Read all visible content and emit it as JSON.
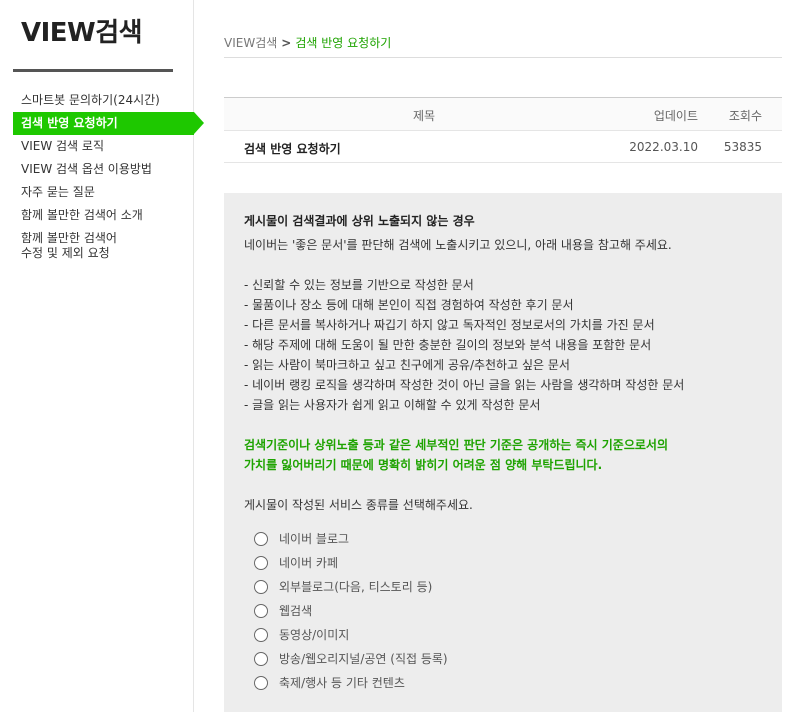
{
  "brand": "VIEW검색",
  "nav": [
    "스마트봇 문의하기(24시간)",
    "검색 반영 요청하기",
    "VIEW 검색 로직",
    "VIEW 검색 옵션 이용방법",
    "자주 묻는 질문",
    "함께 볼만한 검색어 소개",
    "함께 볼만한 검색어\n수정 및 제외 요청"
  ],
  "breadcrumb": {
    "root": "VIEW검색",
    "sep": ">",
    "current": "검색 반영 요청하기"
  },
  "table": {
    "headers": {
      "title": "제목",
      "date": "업데이트",
      "views": "조회수"
    },
    "row": {
      "title": "검색 반영 요청하기",
      "date": "2022.03.10",
      "views": "53835"
    }
  },
  "panel": {
    "heading": "게시물이 검색결과에 상위 노출되지 않는 경우",
    "intro": "네이버는 '좋은 문서'를 판단해 검색에 노출시키고 있으니, 아래 내용을 참고해 주세요.",
    "bullets": [
      "- 신뢰할 수 있는 정보를 기반으로 작성한 문서",
      "- 물품이나 장소 등에 대해 본인이 직접 경험하여 작성한 후기 문서",
      "- 다른 문서를 복사하거나 짜깁기 하지 않고 독자적인 정보로서의 가치를 가진 문서",
      "- 해당 주제에 대해 도움이 될 만한 충분한 길이의 정보와 분석 내용을 포함한 문서",
      "- 읽는 사람이 북마크하고 싶고 친구에게 공유/추천하고 싶은 문서",
      "- 네이버 랭킹 로직을 생각하며 작성한 것이 아닌 글을 읽는 사람을 생각하며 작성한 문서",
      "- 글을 읽는 사용자가 쉽게 읽고 이해할 수 있게 작성한 문서"
    ],
    "notice_line1": "검색기준이나 상위노출 등과 같은 세부적인 판단 기준은 공개하는 즉시 기준으로서의",
    "notice_line2": "가치를 잃어버리기 때문에 명확히 밝히기 어려운 점 양해 부탁드립니다.",
    "prompt": "게시물이 작성된 서비스 종류를 선택해주세요.",
    "options": [
      "네이버 블로그",
      "네이버 카페",
      "외부블로그(다음, 티스토리 등)",
      "웹검색",
      "동영상/이미지",
      "방송/웹오리지널/공연 (직접 등록)",
      "축제/행사 등 기타 컨텐츠"
    ]
  },
  "colors": {
    "accent": "#1ec800",
    "notice": "#1ea300",
    "panel_bg": "#ededed"
  }
}
